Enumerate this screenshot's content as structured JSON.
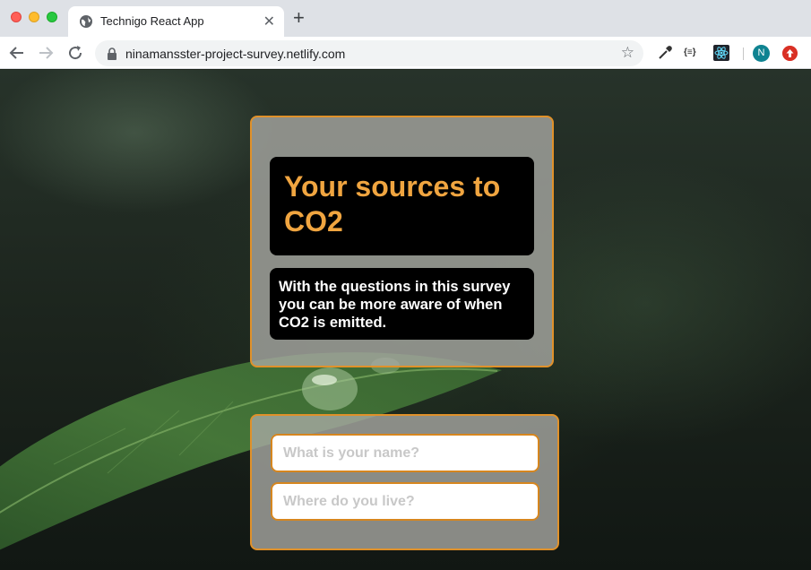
{
  "browser": {
    "tab_title": "Technigo React App",
    "tab_close": "✕",
    "new_tab": "+",
    "url": "ninamansster-project-survey.netlify.com",
    "star": "☆",
    "json_ext": "{≡}",
    "avatar_letter": "N"
  },
  "survey": {
    "title": "Your sources to CO2",
    "description": "With the questions in this survey you can be more aware of when CO2 is emitted.",
    "name_placeholder": "What is your name?",
    "location_placeholder": "Where do you live?"
  },
  "colors": {
    "accent": "#f0a540",
    "card_border": "#e0912a",
    "background": "#1d261d"
  }
}
